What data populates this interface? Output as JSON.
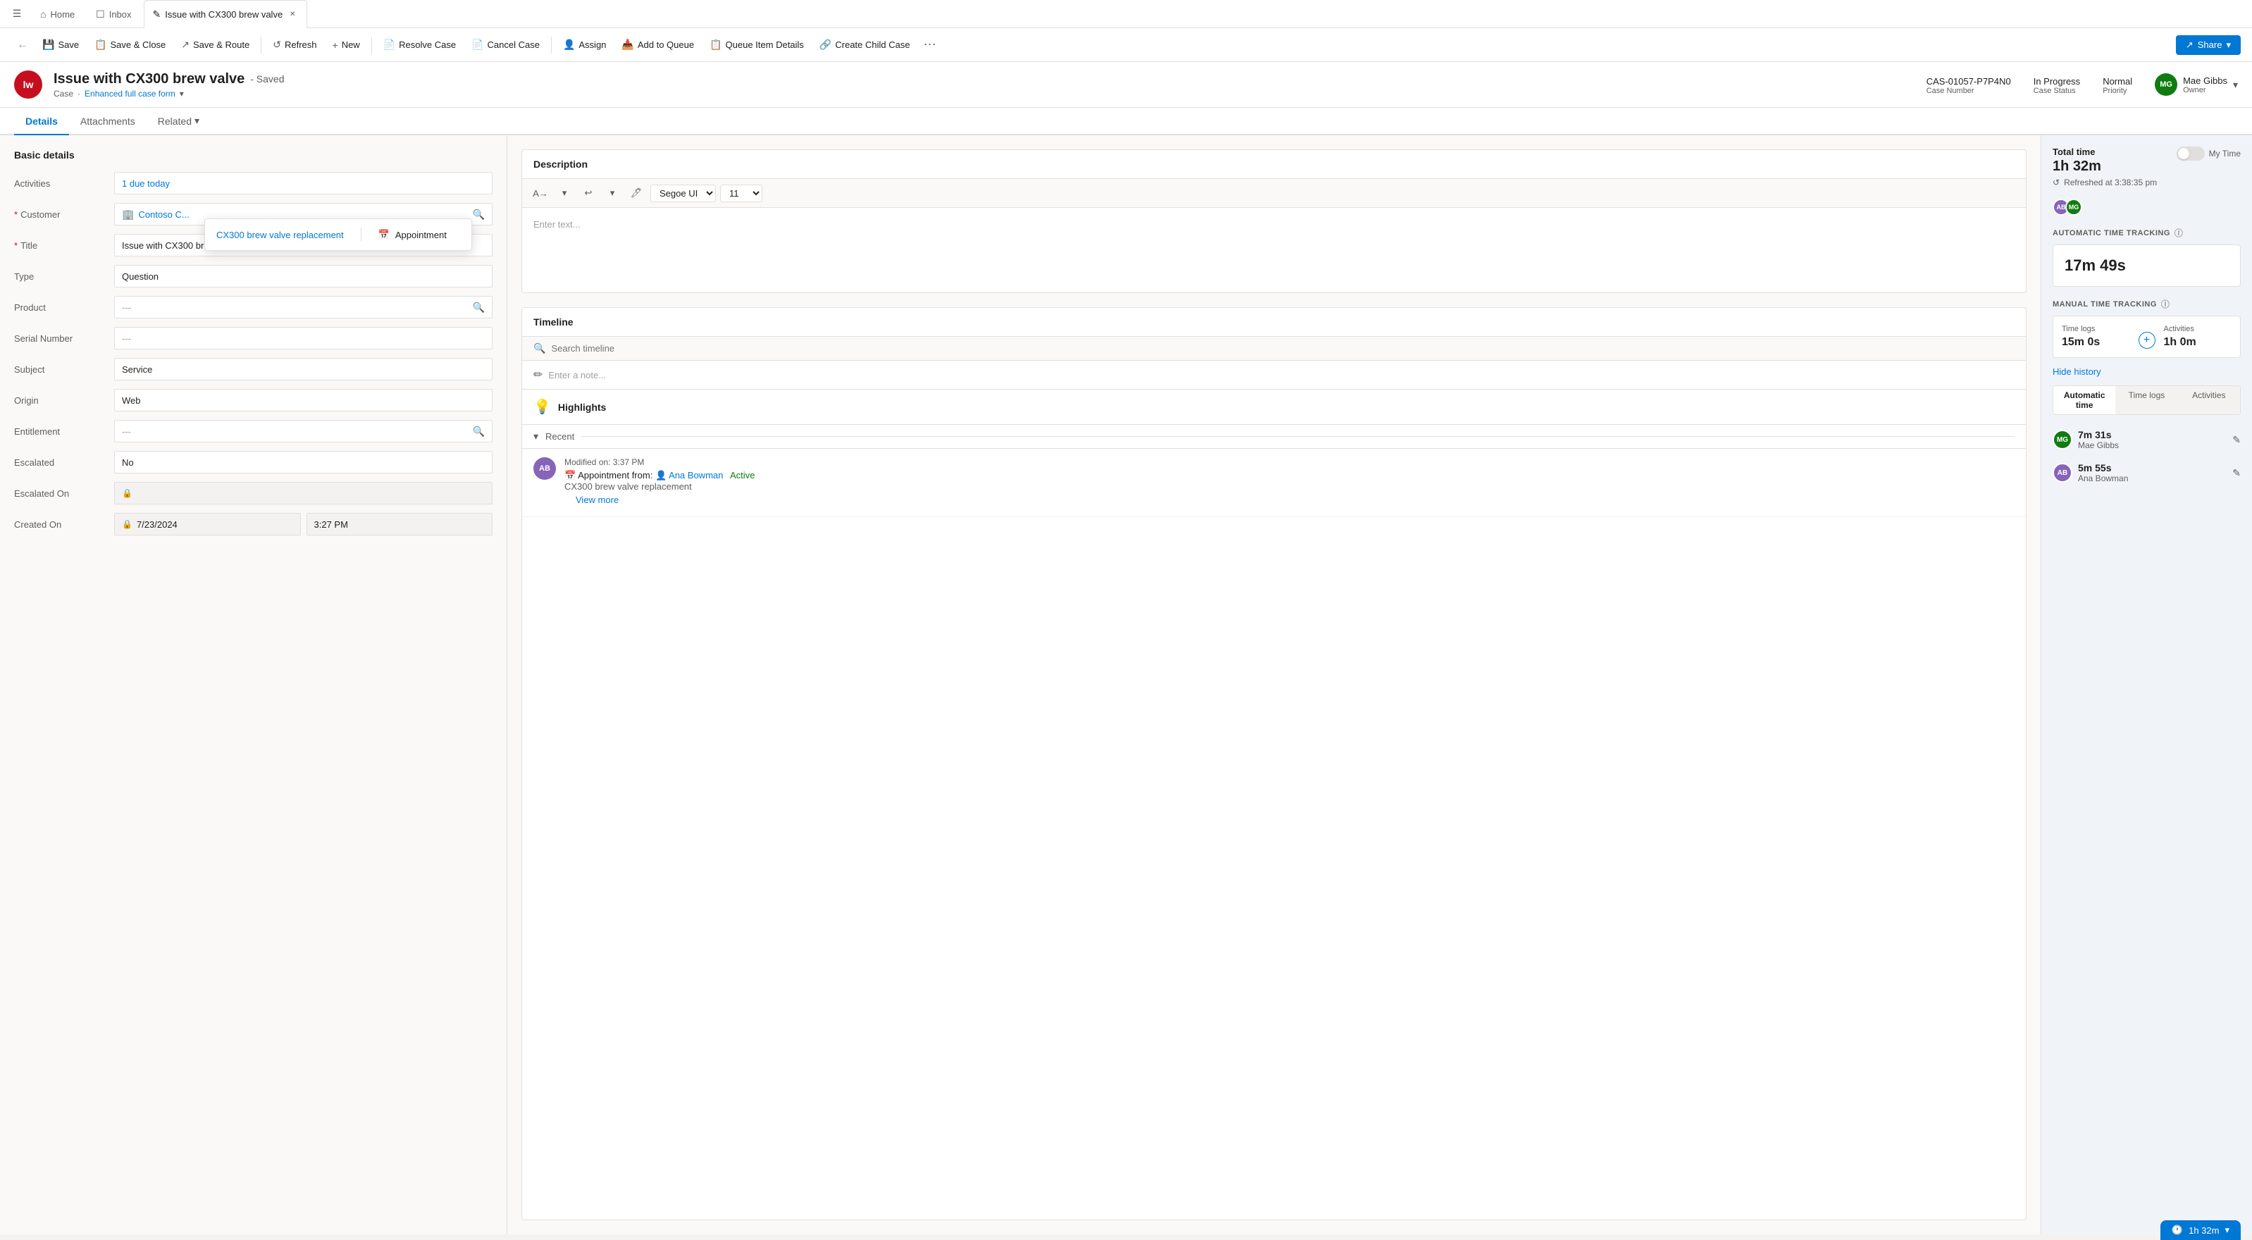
{
  "topnav": {
    "hamburger_label": "☰",
    "tabs": [
      {
        "id": "home",
        "label": "Home",
        "icon": "⌂",
        "closable": false,
        "active": false
      },
      {
        "id": "inbox",
        "label": "Inbox",
        "icon": "☐",
        "closable": false,
        "active": false
      },
      {
        "id": "case",
        "label": "Issue with CX300 brew valve",
        "icon": "✎",
        "closable": true,
        "active": true
      }
    ]
  },
  "commandbar": {
    "back_label": "←",
    "buttons": [
      {
        "id": "save",
        "icon": "💾",
        "label": "Save"
      },
      {
        "id": "save-close",
        "icon": "📋",
        "label": "Save & Close"
      },
      {
        "id": "save-route",
        "icon": "↗",
        "label": "Save & Route"
      },
      {
        "id": "refresh",
        "icon": "↺",
        "label": "Refresh"
      },
      {
        "id": "new",
        "icon": "+",
        "label": "New"
      },
      {
        "id": "resolve-case",
        "icon": "📄",
        "label": "Resolve Case"
      },
      {
        "id": "cancel-case",
        "icon": "📄",
        "label": "Cancel Case"
      },
      {
        "id": "assign",
        "icon": "👤",
        "label": "Assign"
      },
      {
        "id": "add-to-queue",
        "icon": "📥",
        "label": "Add to Queue"
      },
      {
        "id": "queue-item-details",
        "icon": "📋",
        "label": "Queue Item Details"
      },
      {
        "id": "create-child-case",
        "icon": "🔗",
        "label": "Create Child Case"
      }
    ],
    "more_label": "⋯",
    "share_label": "Share"
  },
  "case_header": {
    "avatar_initials": "lw",
    "avatar_bg": "#c50f1f",
    "title": "Issue with CX300 brew valve",
    "saved_badge": "- Saved",
    "subtitle_case": "Case",
    "subtitle_form": "Enhanced full case form",
    "case_number_label": "Case Number",
    "case_number": "CAS-01057-P7P4N0",
    "status_label": "Case Status",
    "status_value": "In Progress",
    "priority_label": "Priority",
    "priority_value": "Normal",
    "owner_label": "Owner",
    "owner_name": "Mae Gibbs",
    "owner_avatar_initials": "MG",
    "owner_avatar_bg": "#107c10"
  },
  "tabs": [
    {
      "id": "details",
      "label": "Details",
      "active": true
    },
    {
      "id": "attachments",
      "label": "Attachments",
      "active": false
    },
    {
      "id": "related",
      "label": "Related",
      "active": false,
      "has_dropdown": true
    }
  ],
  "form": {
    "section_title": "Basic details",
    "fields": [
      {
        "id": "activities",
        "label": "Activities",
        "value": "1 due today",
        "type": "link"
      },
      {
        "id": "customer",
        "label": "Customer",
        "value": "Contoso C...",
        "type": "link",
        "required": true,
        "icon": "🏢"
      },
      {
        "id": "title",
        "label": "Title",
        "value": "Issue with CX300 brew valve",
        "type": "text",
        "required": true
      },
      {
        "id": "type",
        "label": "Type",
        "value": "Question",
        "type": "text"
      },
      {
        "id": "product",
        "label": "Product",
        "value": "---",
        "type": "search"
      },
      {
        "id": "serial_number",
        "label": "Serial Number",
        "value": "---",
        "type": "text"
      },
      {
        "id": "subject",
        "label": "Subject",
        "value": "Service",
        "type": "text"
      },
      {
        "id": "origin",
        "label": "Origin",
        "value": "Web",
        "type": "text"
      },
      {
        "id": "entitlement",
        "label": "Entitlement",
        "value": "---",
        "type": "search"
      },
      {
        "id": "escalated",
        "label": "Escalated",
        "value": "No",
        "type": "text"
      },
      {
        "id": "escalated_on",
        "label": "Escalated On",
        "value": "",
        "type": "lock"
      },
      {
        "id": "created_on",
        "label": "Created On",
        "value": "7/23/2024",
        "type": "lock",
        "time": "3:27 PM"
      }
    ]
  },
  "dropdown_popup": {
    "link_label": "CX300 brew valve replacement",
    "appointment_icon": "📅",
    "appointment_label": "Appointment"
  },
  "description": {
    "title": "Description",
    "toolbar": {
      "translate_icon": "A→",
      "undo_icon": "↩",
      "redo_icon": "↪",
      "highlight_icon": "🖊",
      "font_value": "Segoe UI",
      "size_value": "11"
    },
    "placeholder": "Enter text..."
  },
  "timeline": {
    "title": "Timeline",
    "search_placeholder": "Search timeline",
    "note_placeholder": "Enter a note...",
    "highlights_title": "Highlights",
    "recent_label": "Recent",
    "entries": [
      {
        "id": "entry1",
        "avatar_initials": "AB",
        "avatar_bg": "#8764b8",
        "meta": "Modified on: 3:37 PM",
        "type": "Appointment from:",
        "from_icon": "👤",
        "from_name": "Ana Bowman",
        "status": "Active",
        "title": "CX300 brew valve replacement",
        "view_more": "View more"
      }
    ]
  },
  "time_tracking": {
    "total_label": "Total time",
    "total_value": "1h 32m",
    "my_time_label": "My Time",
    "refresh_label": "Refreshed at 3:38:35 pm",
    "user_dots": [
      {
        "initials": "AB",
        "bg": "#8764b8"
      },
      {
        "initials": "MG",
        "bg": "#107c10"
      }
    ],
    "auto_tracking_title": "AUTOMATIC TIME TRACKING",
    "auto_value": "17m 49s",
    "manual_tracking_title": "MANUAL TIME TRACKING",
    "time_logs_label": "Time logs",
    "time_logs_value": "15m 0s",
    "activities_label": "Activities",
    "activities_value": "1h 0m",
    "hide_history_label": "Hide history",
    "history_tabs": [
      "Automatic time",
      "Time logs",
      "Activities"
    ],
    "history_entries": [
      {
        "id": "mg-entry",
        "initials": "MG",
        "bg": "#107c10",
        "time": "7m 31s",
        "name": "Mae Gibbs"
      },
      {
        "id": "ab-entry",
        "initials": "AB",
        "bg": "#8764b8",
        "time": "5m 55s",
        "name": "Ana Bowman"
      }
    ],
    "status_bar_value": "1h 32m"
  }
}
